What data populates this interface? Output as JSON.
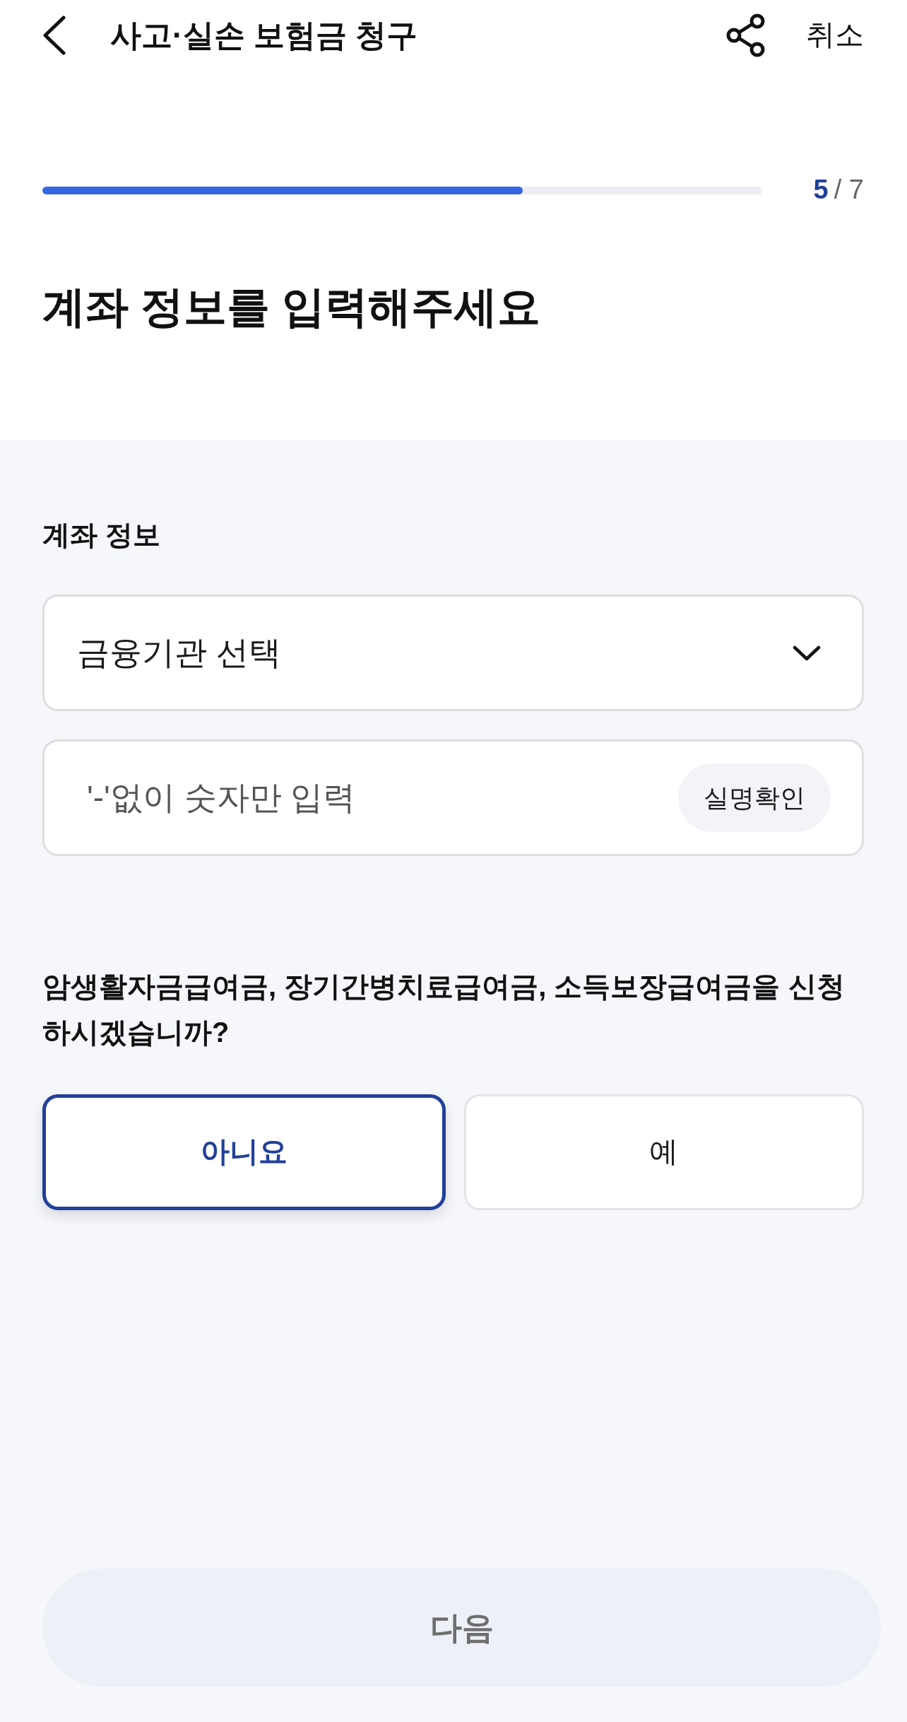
{
  "header": {
    "title": "사고·실손 보험금 청구",
    "cancel": "취소"
  },
  "progress": {
    "level": 0.667,
    "current": "5",
    "total": "/ 7"
  },
  "heading": "계좌 정보를 입력해주세요",
  "account": {
    "label": "계좌 정보",
    "bank_select": {
      "value": "금융기관 선택"
    },
    "account_number": {
      "placeholder": "'-'없이 숫자만 입력",
      "verify_button": "실명확인"
    }
  },
  "question": {
    "text": "암생활자금급여금, 장기간병치료급여금, 소득보장급여금을 신청하시겠습니까?",
    "options": [
      {
        "label": "아니요",
        "selected": true
      },
      {
        "label": "예",
        "selected": false
      }
    ]
  },
  "next_button": {
    "label": "다음",
    "disabled": true
  }
}
